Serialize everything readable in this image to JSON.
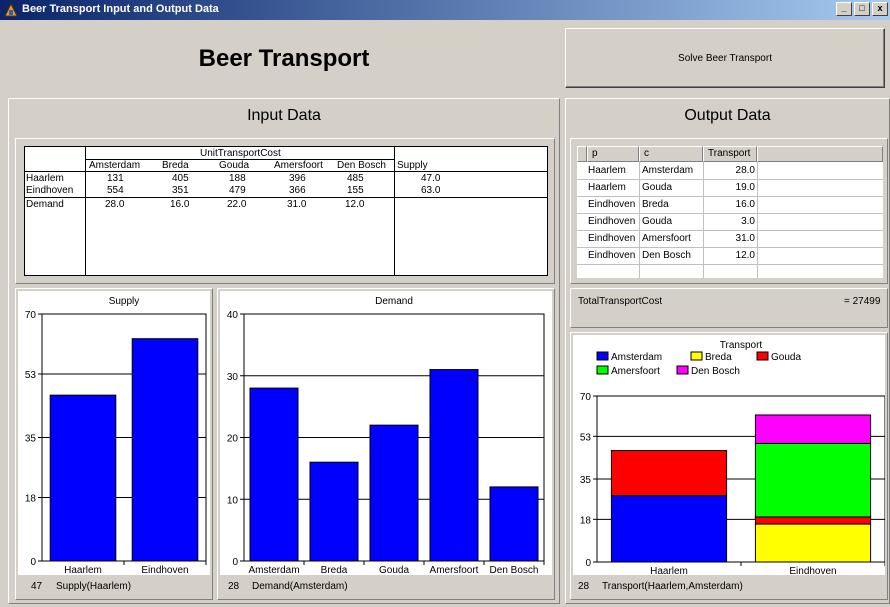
{
  "window": {
    "title": "Beer Transport Input and Output Data",
    "minimize": "_",
    "maximize": "□",
    "close": "x"
  },
  "app_title": "Beer Transport",
  "solve_button": "Solve Beer Transport",
  "input_panel": {
    "title": "Input Data",
    "group_header": "UnitTransportCost",
    "columns": [
      "Amsterdam",
      "Breda",
      "Gouda",
      "Amersfoort",
      "Den Bosch"
    ],
    "supply_header": "Supply",
    "rows": [
      {
        "label": "Haarlem",
        "costs": [
          "131",
          "405",
          "188",
          "396",
          "485"
        ],
        "supply": "47.0"
      },
      {
        "label": "Eindhoven",
        "costs": [
          "554",
          "351",
          "479",
          "366",
          "155"
        ],
        "supply": "63.0"
      }
    ],
    "demand_row": {
      "label": "Demand",
      "values": [
        "28.0",
        "16.0",
        "22.0",
        "31.0",
        "12.0"
      ]
    }
  },
  "output_panel": {
    "title": "Output Data",
    "columns": [
      "p",
      "c",
      "Transport"
    ],
    "rows": [
      [
        "Haarlem",
        "Amsterdam",
        "28.0"
      ],
      [
        "Haarlem",
        "Gouda",
        "19.0"
      ],
      [
        "Eindhoven",
        "Breda",
        "16.0"
      ],
      [
        "Eindhoven",
        "Gouda",
        "3.0"
      ],
      [
        "Eindhoven",
        "Amersfoort",
        "31.0"
      ],
      [
        "Eindhoven",
        "Den Bosch",
        "12.0"
      ]
    ],
    "total_label": "TotalTransportCost",
    "total_value": "= 27499"
  },
  "chart_data": [
    {
      "type": "bar",
      "title": "Supply",
      "categories": [
        "Haarlem",
        "Eindhoven"
      ],
      "values": [
        47,
        63
      ],
      "ylim": [
        0,
        70
      ],
      "yticks": [
        "0",
        "18",
        "35",
        "53",
        "70"
      ],
      "grid": true,
      "color": "#0000ff",
      "status_value": "47",
      "status_label": "Supply(Haarlem)"
    },
    {
      "type": "bar",
      "title": "Demand",
      "categories": [
        "Amsterdam",
        "Breda",
        "Gouda",
        "Amersfoort",
        "Den Bosch"
      ],
      "values": [
        28,
        16,
        22,
        31,
        12
      ],
      "ylim": [
        0,
        40
      ],
      "yticks": [
        "0",
        "10",
        "20",
        "30",
        "40"
      ],
      "grid": true,
      "color": "#0000ff",
      "status_value": "28",
      "status_label": "Demand(Amsterdam)"
    },
    {
      "type": "bar",
      "stacked": true,
      "title": "Transport",
      "categories": [
        "Haarlem",
        "Eindhoven"
      ],
      "series": [
        {
          "name": "Amsterdam",
          "color": "#0000ff",
          "values": [
            28,
            0
          ]
        },
        {
          "name": "Breda",
          "color": "#ffff00",
          "values": [
            0,
            16
          ]
        },
        {
          "name": "Gouda",
          "color": "#ff0000",
          "values": [
            19,
            3
          ]
        },
        {
          "name": "Amersfoort",
          "color": "#00ff00",
          "values": [
            0,
            31
          ]
        },
        {
          "name": "Den Bosch",
          "color": "#ff00ff",
          "values": [
            0,
            12
          ]
        }
      ],
      "ylim": [
        0,
        70
      ],
      "yticks": [
        "0",
        "18",
        "35",
        "53",
        "70"
      ],
      "grid": true,
      "legend": "top",
      "status_value": "28",
      "status_label": "Transport(Haarlem,Amsterdam)"
    }
  ]
}
